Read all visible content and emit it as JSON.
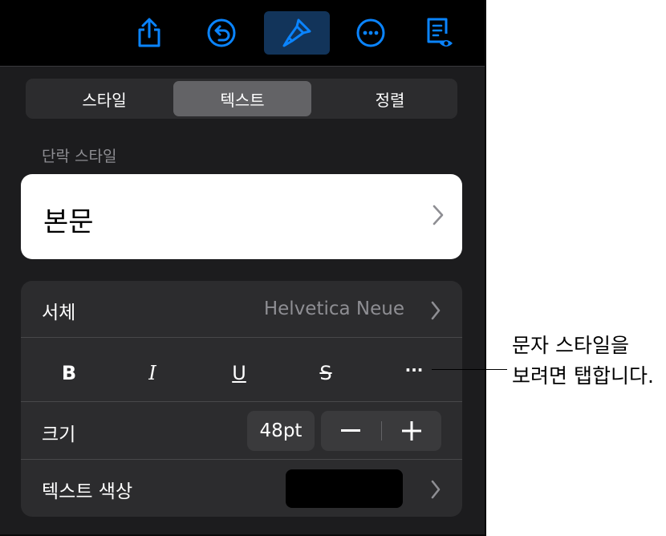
{
  "toolbar": {
    "buttons": [
      {
        "icon": "share-icon"
      },
      {
        "icon": "undo-icon"
      },
      {
        "icon": "format-brush-icon",
        "active": true
      },
      {
        "icon": "more-icon"
      },
      {
        "icon": "reading-view-icon"
      }
    ]
  },
  "tabs": [
    "스타일",
    "텍스트",
    "정렬"
  ],
  "selected_tab": "텍스트",
  "paragraph_style": {
    "label": "단락 스타일",
    "value": "본문"
  },
  "font": {
    "label": "서체",
    "value": "Helvetica Neue"
  },
  "style_buttons": [
    "B",
    "I",
    "U",
    "S",
    "···"
  ],
  "size": {
    "label": "크기",
    "value": "48pt"
  },
  "text_color": {
    "label": "텍스트 색상",
    "swatch": "#000000"
  },
  "callout": {
    "line1": "문자 스타일을",
    "line2": "보려면 탭합니다."
  },
  "colors": {
    "accent": "#0a84ff",
    "panel": "#1c1c1e",
    "group": "#2c2c2e"
  }
}
